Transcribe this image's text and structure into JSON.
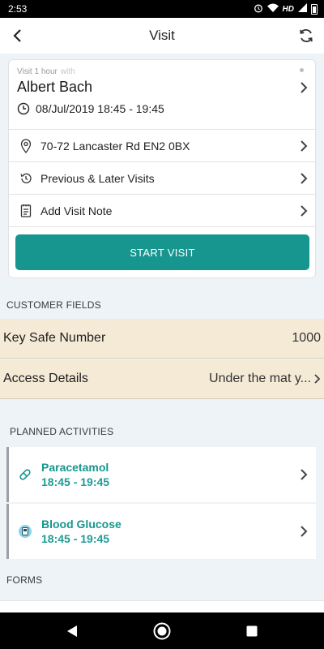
{
  "status_bar": {
    "time": "2:53",
    "network": "HD"
  },
  "app_bar": {
    "title": "Visit"
  },
  "visit": {
    "subtitle": "Visit 1 hour",
    "with_label": "with",
    "client_name": "Albert Bach",
    "datetime": "08/Jul/2019 18:45 - 19:45",
    "address": "70-72 Lancaster Rd  EN2 0BX",
    "previous_later_label": "Previous & Later Visits",
    "add_note_label": "Add Visit Note",
    "start_button": "START VISIT"
  },
  "customer_fields": {
    "heading": "CUSTOMER FIELDS",
    "items": [
      {
        "label": "Key Safe Number",
        "value": "1000"
      },
      {
        "label": "Access Details",
        "value": "Under the mat y..."
      }
    ]
  },
  "planned_activities": {
    "heading": "PLANNED ACTIVITIES",
    "items": [
      {
        "name": "Paracetamol",
        "time": "18:45 - 19:45",
        "icon": "pill-icon"
      },
      {
        "name": "Blood Glucose",
        "time": "18:45 - 19:45",
        "icon": "blood-glucose-icon"
      }
    ]
  },
  "forms": {
    "heading": "FORMS"
  },
  "colors": {
    "accent": "#16968f",
    "customer_field_bg": "#f5ead6",
    "page_bg": "#eef3f7"
  }
}
